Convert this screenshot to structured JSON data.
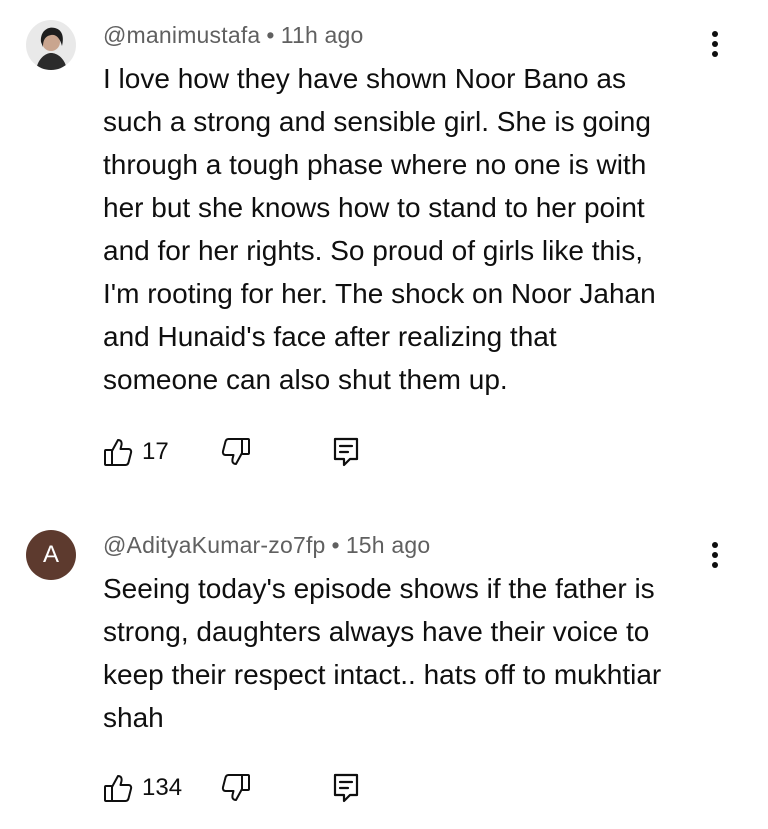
{
  "comments": [
    {
      "avatar": "user-photo-avatar",
      "handle": "@manimustafa",
      "separator": "•",
      "time": "11h ago",
      "text_lines": [
        "I love how they have shown Noor Bano as",
        "such a strong and sensible girl. She is going",
        "through a tough phase where no one is with",
        "her but she knows how to stand to her point",
        "and for her rights. So proud of girls like this,",
        "I'm rooting for her. The shock on Noor Jahan",
        "and Hunaid's face after realizing that",
        "someone can also shut them up."
      ],
      "likes": "17"
    },
    {
      "avatar_letter": "A",
      "avatar_color": "#5d3a2e",
      "handle": "@AdityaKumar-zo7fp",
      "separator": "•",
      "time": "15h ago",
      "text_lines": [
        "Seeing today's episode shows if the father is",
        "strong, daughters always have their voice to",
        "keep their respect intact.. hats off to mukhtiar",
        "shah"
      ],
      "likes": "134"
    }
  ],
  "icons": {
    "like": "thumb-up-icon",
    "dislike": "thumb-down-icon",
    "reply": "reply-comment-icon",
    "more": "more-vert-icon"
  }
}
